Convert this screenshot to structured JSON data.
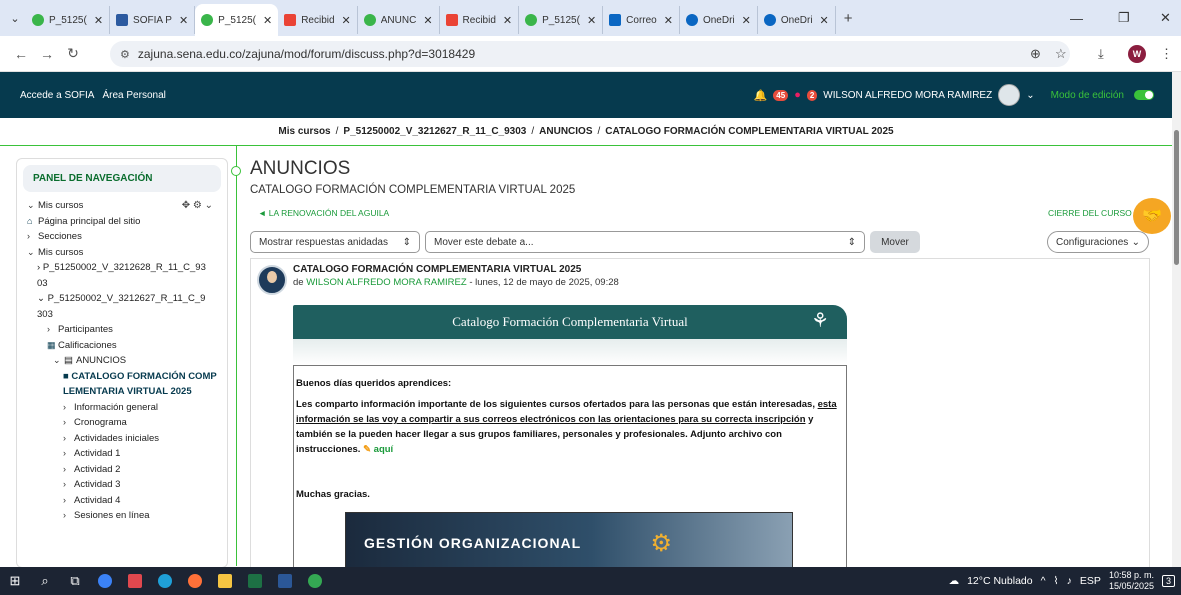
{
  "browser": {
    "tabs": [
      {
        "label": "P_5125(",
        "favicon_color": "#3ab54a",
        "active": false
      },
      {
        "label": "SOFIA P",
        "favicon_color": "#2c5aa0",
        "active": false
      },
      {
        "label": "P_5125(",
        "favicon_color": "#3ab54a",
        "active": true
      },
      {
        "label": "Recibid",
        "favicon_color": "#ea4335",
        "active": false
      },
      {
        "label": "ANUNC",
        "favicon_color": "#3ab54a",
        "active": false
      },
      {
        "label": "Recibid",
        "favicon_color": "#ea4335",
        "active": false
      },
      {
        "label": "P_5125(",
        "favicon_color": "#3ab54a",
        "active": false
      },
      {
        "label": "Correo",
        "favicon_color": "#0a66c2",
        "active": false
      },
      {
        "label": "OneDri",
        "favicon_color": "#0a66c2",
        "active": false
      },
      {
        "label": "OneDri",
        "favicon_color": "#0a66c2",
        "active": false
      }
    ],
    "new_tab": "+",
    "url": "zajuna.sena.edu.co/zajuna/mod/forum/discuss.php?d=3018429",
    "profile_initial": "W"
  },
  "header": {
    "link_sofia": "Accede a SOFIA",
    "link_personal": "Área Personal",
    "notif_count": "45",
    "msg_count": "2",
    "user_name": "WILSON ALFREDO MORA RAMIREZ",
    "edit_mode": "Modo de edición"
  },
  "breadcrumb": {
    "items": [
      "Mis cursos",
      "P_51250002_V_3212627_R_11_C_9303",
      "ANUNCIOS",
      "CATALOGO FORMACIÓN COMPLEMENTARIA VIRTUAL 2025"
    ],
    "sep": "/"
  },
  "sidebar": {
    "title": "PANEL DE NAVEGACIÓN",
    "my_courses": "Mis cursos",
    "home": "Página principal del sitio",
    "sections": "Secciones",
    "my_courses_2": "Mis cursos",
    "course1": "P_51250002_V_3212628_R_11_C_9303",
    "course2": "P_51250002_V_3212627_R_11_C_9303",
    "participants": "Participantes",
    "grades": "Calificaciones",
    "announcements": "ANUNCIOS",
    "current": "CATALOGO FORMACIÓN COMPLEMENTARIA VIRTUAL 2025",
    "items": [
      "Información general",
      "Cronograma",
      "Actividades iniciales",
      "Actividad 1",
      "Actividad 2",
      "Actividad 3",
      "Actividad 4",
      "Sesiones en línea"
    ]
  },
  "main": {
    "title": "ANUNCIOS",
    "subtitle": "CATALOGO FORMACIÓN COMPLEMENTARIA VIRTUAL 2025",
    "prev_link": "◄ LA RENOVACIÓN DEL AGUILA",
    "next_link": "CIERRE DEL CURSO ►",
    "display_select": "Mostrar respuestas anidadas",
    "move_select": "Mover este debate a...",
    "move_button": "Mover",
    "settings_button": "Configuraciones"
  },
  "post": {
    "title": "CATALOGO FORMACIÓN COMPLEMENTARIA VIRTUAL 2025",
    "by": "de",
    "author": "WILSON ALFREDO MORA RAMIREZ",
    "date": " - lunes, 12 de mayo de 2025, 09:28",
    "banner_title": "Catalogo Formación Complementaria Virtual",
    "greeting": "Buenos días queridos aprendices:",
    "body_1": "Les comparto información importante de los siguientes cursos ofertados para las personas que están interesadas, ",
    "body_underline": "esta información se las voy a compartir a sus correos electrónicos con las orientaciones para su correcta inscripción",
    "body_2": " y también se la pueden hacer llegar a sus grupos familiares, personales y profesionales.",
    "body_3": "Adjunto archivo con instrucciones.",
    "link_here": "aquí",
    "thanks": "Muchas gracias.",
    "image_caption": "GESTIÓN ORGANIZACIONAL"
  },
  "taskbar": {
    "weather": "12°C  Nublado",
    "lang": "ESP",
    "time": "10:58 p. m.",
    "date": "15/05/2025",
    "notif": "3"
  }
}
